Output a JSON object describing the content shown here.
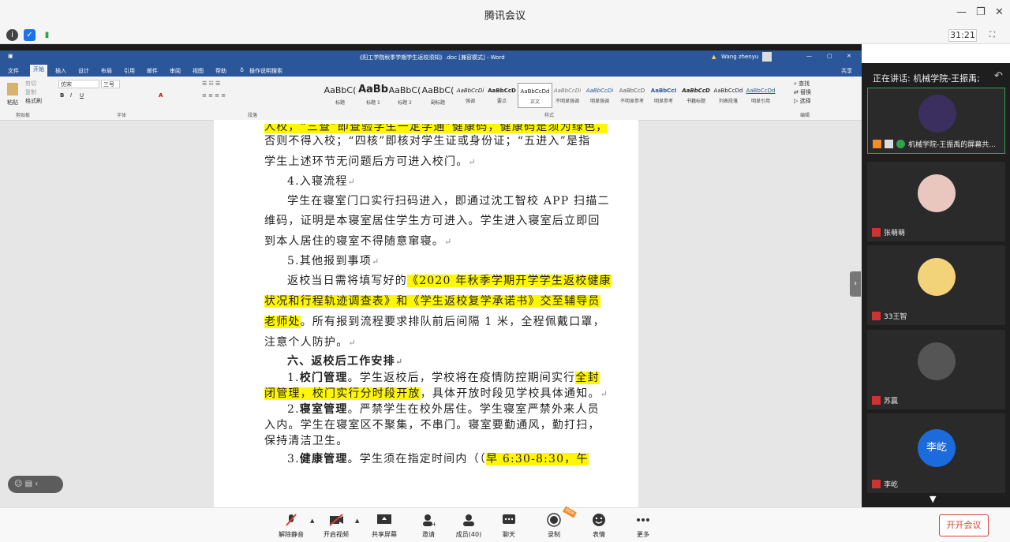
{
  "window": {
    "title": "腾讯会议",
    "timer": "31:21"
  },
  "word": {
    "doc_title": "《阳工学院秋季学期学生返校须知》.doc [兼容模式] - Word",
    "user": "Wang zhenyu",
    "menu": [
      "文件",
      "开始",
      "插入",
      "设计",
      "布局",
      "引用",
      "邮件",
      "审阅",
      "视图",
      "帮助",
      "操作说明搜索"
    ],
    "share": "共享",
    "clipboard": {
      "paste": "粘贴",
      "cut": "剪切",
      "copy": "复制",
      "format_painter": "格式刷",
      "group": "剪贴板"
    },
    "font": {
      "name": "仿宋",
      "size": "三号",
      "group": "字体"
    },
    "paragraph_group": "段落",
    "styles_group": "样式",
    "editing": {
      "find": "查找",
      "replace": "替换",
      "select": "选择",
      "group": "编辑"
    },
    "styles": [
      {
        "sample": "AaBbC(",
        "name": "标题"
      },
      {
        "sample": "AaBb",
        "name": "标题 1"
      },
      {
        "sample": "AaBbC(",
        "name": "标题 2"
      },
      {
        "sample": "AaBbC(",
        "name": "副标题"
      },
      {
        "sample": "AaBbCcDi",
        "name": "强调"
      },
      {
        "sample": "AaBbCcD",
        "name": "要点"
      },
      {
        "sample": "AaBbCcDd",
        "name": "正文"
      },
      {
        "sample": "AaBbCcDi",
        "name": "不明显强调"
      },
      {
        "sample": "AaBbCcDi",
        "name": "明显强调"
      },
      {
        "sample": "AaBbCcD",
        "name": "不明显参考"
      },
      {
        "sample": "AaBbCcI",
        "name": "明显参考"
      },
      {
        "sample": "AaBbCcD",
        "name": "书籍标题"
      },
      {
        "sample": "AaBbCcDd",
        "name": "列表段落"
      },
      {
        "sample": "AaBbCcDd",
        "name": "明显引用"
      }
    ]
  },
  "document": {
    "l0": "人校，“三查”即查验学生一定学通”健康码，健康码是须为绿色，",
    "l1": "否则不得入校；“四核”即核对学生证或身份证；“五进入”是指",
    "l2": "学生上述环节无问题后方可进入校门。",
    "l3": "4.入寝流程",
    "l4": "学生在寝室门口实行扫码进入，即通过沈工智校 APP 扫描二",
    "l5": "维码，证明是本寝室居住学生方可进入。学生进入寝室后立即回",
    "l6": "到本人居住的寝室不得随意窜寝。",
    "l7": "5.其他报到事项",
    "l8a": "返校当日需将填写好的",
    "l8b": "《2020 年秋季学期开学学生返校健康",
    "l9": "状况和行程轨迹调查表》和《学生返校复学承诺书》交至辅导员",
    "l10a": "老师处",
    "l10b": "。所有报到流程要求排队前后间隔 1 米，全程佩戴口罩，",
    "l11": "注意个人防护。",
    "l12": "六、返校后工作安排",
    "l13a": "1.",
    "l13b": "校门管理",
    "l13c": "。学生返校后，学校将在疫情防控期间实行",
    "l13d": "全封",
    "l14a": "闭管理，校门实行分时段开放",
    "l14b": "，具体开放时段见学校具体通知。",
    "l15a": "2.",
    "l15b": "寝室管理",
    "l15c": "。严禁学生在校外居住。学生寝室严禁外来人员",
    "l16": "入内。学生在寝室区不聚集，不串门。寝室要勤通风，勤打扫，",
    "l17": "保持清洁卫生。",
    "l18a": "3.",
    "l18b": "健康管理",
    "l18c": "。学生须在指定时间内（（",
    "l18d": "早 6:30-8:30，午"
  },
  "sidebar": {
    "speaking": "正在讲话: 机械学院-王振禹;",
    "participants": [
      {
        "name": "机械学院-王振禹的屏幕共..."
      },
      {
        "name": "张萌萌"
      },
      {
        "name": "33王智"
      },
      {
        "name": "苏赢"
      },
      {
        "name": "李屹",
        "avatar_text": "李屹"
      }
    ]
  },
  "toolbar": {
    "unmute": "解除静音",
    "video": "开启视频",
    "share": "共享屏幕",
    "invite": "邀请",
    "members": "成员(40)",
    "chat": "聊天",
    "record": "录制",
    "emoji": "表情",
    "more": "更多",
    "leave": "开开会议",
    "record_badge": "NEW"
  },
  "colors": {
    "word_blue": "#2b579a",
    "highlight": "#fff700",
    "leave_red": "#d9413a"
  }
}
